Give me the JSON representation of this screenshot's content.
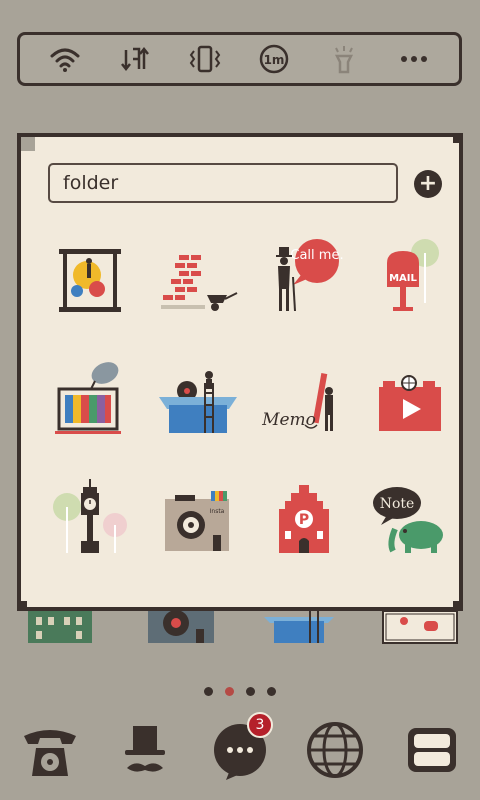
{
  "toggles": [
    {
      "name": "wifi-icon"
    },
    {
      "name": "data-sync-icon"
    },
    {
      "name": "vibrate-icon"
    },
    {
      "name": "timeout-icon",
      "label": "1m"
    },
    {
      "name": "flashlight-icon"
    },
    {
      "name": "more-icon"
    }
  ],
  "folder": {
    "name": "folder",
    "apps": [
      {
        "icon": "gallery-painter-icon"
      },
      {
        "icon": "brick-wall-wheelbarrow-icon"
      },
      {
        "icon": "call-me-gentleman-icon",
        "text": "Call me."
      },
      {
        "icon": "mailbox-icon",
        "text": "MAIL"
      },
      {
        "icon": "tv-satellite-icon"
      },
      {
        "icon": "box-ladder-icon"
      },
      {
        "icon": "memo-pencil-icon",
        "text": "Memo"
      },
      {
        "icon": "video-camera-icon"
      },
      {
        "icon": "clock-tower-icon"
      },
      {
        "icon": "instant-camera-icon",
        "text": "Insta"
      },
      {
        "icon": "red-building-p-icon",
        "text": "P"
      },
      {
        "icon": "note-elephant-icon",
        "text": "Note"
      }
    ]
  },
  "page_indicator": {
    "count": 4,
    "active": 1
  },
  "dock": [
    {
      "name": "phone-icon"
    },
    {
      "name": "top-hat-mustache-icon"
    },
    {
      "name": "messages-icon",
      "badge": "3"
    },
    {
      "name": "globe-icon"
    },
    {
      "name": "apps-drawer-icon"
    }
  ],
  "colors": {
    "dark": "#3a302c",
    "paper": "#f2eadc",
    "red": "#d94c4a",
    "background": "#a8a398"
  }
}
